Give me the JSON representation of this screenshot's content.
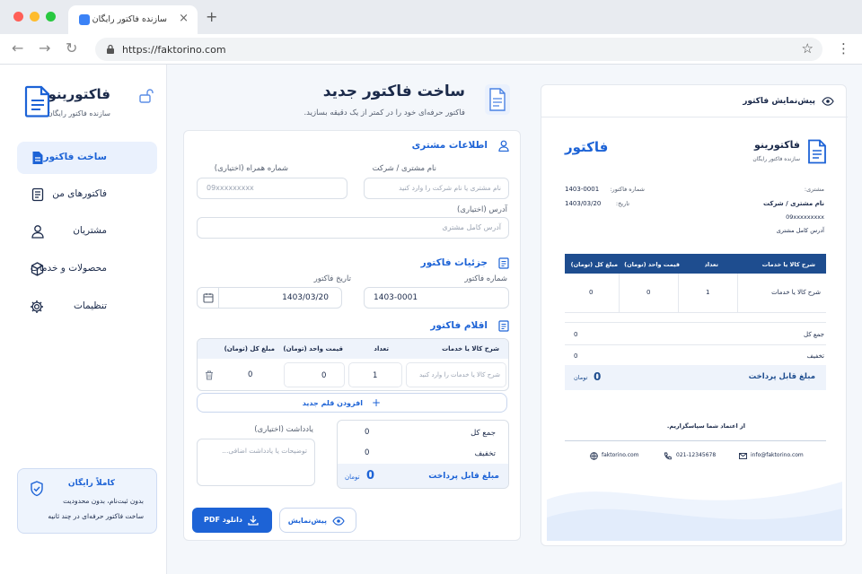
{
  "browser": {
    "tab_title": "سازنده فاکتور رایگان",
    "tab_close": "×",
    "new_tab": "+",
    "url": "https://faktorino.com",
    "back": "←",
    "forward": "→",
    "reload": "↻",
    "star": "☆",
    "menu": "⋮"
  },
  "brand": {
    "name": "فاکتورینو",
    "tagline": "سازنده فاکتور رایگان"
  },
  "sidebar": {
    "items": [
      {
        "label": "ساخت فاکتور",
        "icon": "document-icon",
        "active": true
      },
      {
        "label": "فاکتورهای من",
        "icon": "list-icon"
      },
      {
        "label": "مشتریان",
        "icon": "user-icon"
      },
      {
        "label": "محصولات و خدمات",
        "icon": "box-icon"
      },
      {
        "label": "تنظیمات",
        "icon": "gear-icon"
      }
    ],
    "promo": {
      "title": "کاملاً رایگان",
      "line1": "بدون ثبت‌نام، بدون محدودیت",
      "line2": "ساخت فاکتور حرفه‌ای در چند ثانیه"
    }
  },
  "header": {
    "title": "ساخت فاکتور جدید",
    "subtitle": "فاکتور حرفه‌ای خود را در کمتر از یک دقیقه بسازید."
  },
  "customer": {
    "section_title": "اطلاعات مشتری",
    "name_label": "نام مشتری / شرکت",
    "name_placeholder": "نام مشتری یا نام شرکت را وارد کنید",
    "phone_label": "شماره همراه (اختیاری)",
    "phone_placeholder": "09xxxxxxxxx",
    "address_label": "آدرس (اختیاری)",
    "address_placeholder": "آدرس کامل مشتری"
  },
  "invoice_details": {
    "section_title": "جزئیات فاکتور",
    "number_label": "شماره فاکتور",
    "number_value": "1403-0001",
    "date_label": "تاریخ فاکتور",
    "date_value": "1403/03/20"
  },
  "items": {
    "section_title": "اقلام فاکتور",
    "headers": [
      "شرح کالا یا خدمات",
      "تعداد",
      "قیمت واحد (تومان)",
      "مبلغ کل (تومان)"
    ],
    "row": {
      "description_placeholder": "شرح کالا یا خدمات را وارد کنید",
      "qty": "1",
      "price": "0",
      "total": "0"
    },
    "add_label": "افزودن قلم جدید"
  },
  "note": {
    "label": "یادداشت (اختیاری)",
    "placeholder": "توضیحات یا یادداشت اضافی..."
  },
  "summary": {
    "subtotal_label": "جمع کل",
    "subtotal": "0",
    "discount_label": "تخفیف",
    "discount": "0",
    "payable_label": "مبلغ قابل پرداخت",
    "payable": "0",
    "currency": "تومان"
  },
  "actions": {
    "download_label": "دانلود PDF",
    "preview_label": "پیش‌نمایش"
  },
  "preview": {
    "panel_title": "پیش‌نمایش فاکتور",
    "doc_title": "فاکتور",
    "brand_name": "فاکتورینو",
    "brand_tagline": "سازنده فاکتور رایگان",
    "invoice_number_label": "شماره فاکتور:",
    "invoice_number": "1403-0001",
    "date_label": "تاریخ:",
    "date": "1403/03/20",
    "customer_heading": "مشتری:",
    "customer_name": "نام مشتری / شرکت",
    "customer_phone": "09xxxxxxxxx",
    "customer_address": "آدرس کامل مشتری",
    "headers": [
      "شرح کالا یا خدمات",
      "تعداد",
      "قیمت واحد (تومان)",
      "مبلغ کل (تومان)"
    ],
    "row": {
      "description": "شرح کالا یا خدمات",
      "qty": "1",
      "price": "0",
      "total": "0"
    },
    "subtotal_label": "جمع کل",
    "subtotal": "0",
    "discount_label": "تخفیف",
    "discount": "0",
    "payable_label": "مبلغ قابل پرداخت",
    "payable": "0",
    "currency": "تومان",
    "thanks": "از اعتماد شما سپاسگزاریم.",
    "email": "info@faktorino.com",
    "phone": "021-12345678",
    "website": "faktorino.com"
  },
  "colors": {
    "primary": "#1d63d6",
    "table_header": "#1e4d8f",
    "background": "#f4f7fb"
  }
}
